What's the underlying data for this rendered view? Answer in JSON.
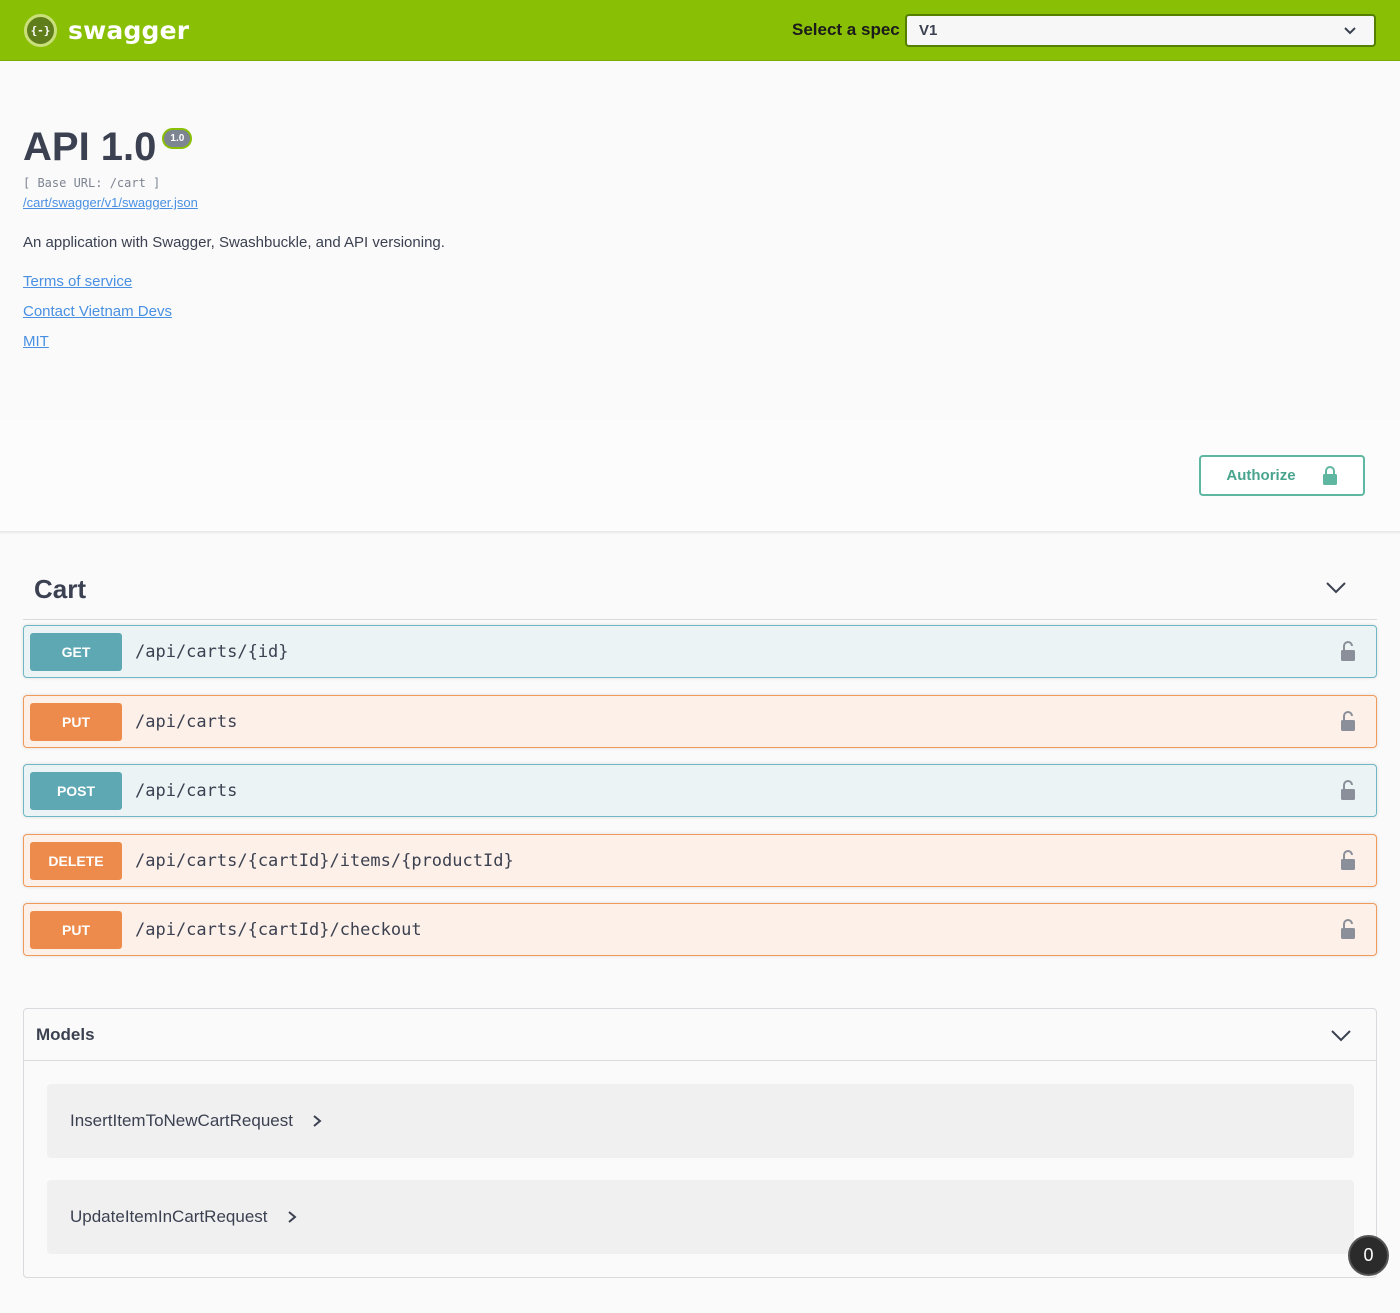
{
  "topbar": {
    "logo_symbol": "{-}",
    "logo_text": "swagger",
    "spec_label": "Select a spec",
    "spec_value": "V1"
  },
  "info": {
    "title": "API 1.0",
    "version_badge": "1.0",
    "base_url": "[ Base URL: /cart ]",
    "json_link": "/cart/swagger/v1/swagger.json",
    "description": "An application with Swagger, Swashbuckle, and API versioning.",
    "links": [
      "Terms of service",
      "Contact Vietnam Devs",
      "MIT"
    ]
  },
  "authorize": {
    "label": "Authorize",
    "icon": "lock-icon"
  },
  "tag": {
    "title": "Cart"
  },
  "operations": [
    {
      "method": "GET",
      "path": "/api/carts/{id}"
    },
    {
      "method": "PUT",
      "path": "/api/carts"
    },
    {
      "method": "POST",
      "path": "/api/carts"
    },
    {
      "method": "DELETE",
      "path": "/api/carts/{cartId}/items/{productId}"
    },
    {
      "method": "PUT",
      "path": "/api/carts/{cartId}/checkout"
    }
  ],
  "models": {
    "title": "Models",
    "items": [
      "InsertItemToNewCartRequest",
      "UpdateItemInCartRequest"
    ]
  },
  "notification_count": "0",
  "colors": {
    "topbar": "#89bf04",
    "get_post": "#5ea8b4",
    "put_delete": "#ec8b4c",
    "link": "#4990e2"
  }
}
